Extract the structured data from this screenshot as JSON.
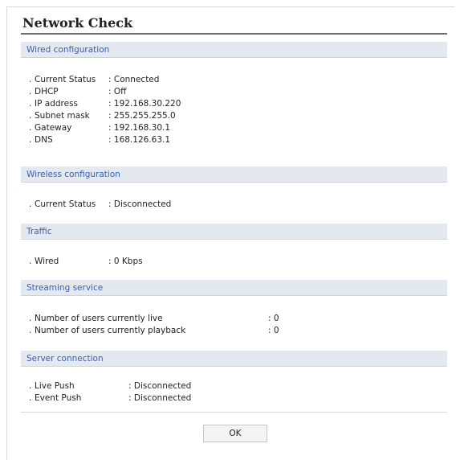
{
  "title": "Network Check",
  "sections": {
    "wired": {
      "header": "Wired configuration",
      "rows": [
        {
          "label": "Current Status",
          "value": "Connected"
        },
        {
          "label": "DHCP",
          "value": "Off"
        },
        {
          "label": "IP address",
          "value": "192.168.30.220"
        },
        {
          "label": "Subnet mask",
          "value": "255.255.255.0"
        },
        {
          "label": "Gateway",
          "value": "192.168.30.1"
        },
        {
          "label": "DNS",
          "value": "168.126.63.1"
        }
      ]
    },
    "wireless": {
      "header": "Wireless configuration",
      "rows": [
        {
          "label": "Current Status",
          "value": "Disconnected"
        }
      ]
    },
    "traffic": {
      "header": "Traffic",
      "rows": [
        {
          "label": "Wired",
          "value": "0 Kbps"
        }
      ]
    },
    "streaming": {
      "header": "Streaming service",
      "rows": [
        {
          "label": "Number of users currently live",
          "value": "0"
        },
        {
          "label": "Number of users currently playback",
          "value": "0"
        }
      ]
    },
    "server": {
      "header": "Server connection",
      "rows": [
        {
          "label": "Live Push",
          "value": "Disconnected"
        },
        {
          "label": "Event Push",
          "value": "Disconnected"
        }
      ]
    }
  },
  "ok_label": "OK"
}
